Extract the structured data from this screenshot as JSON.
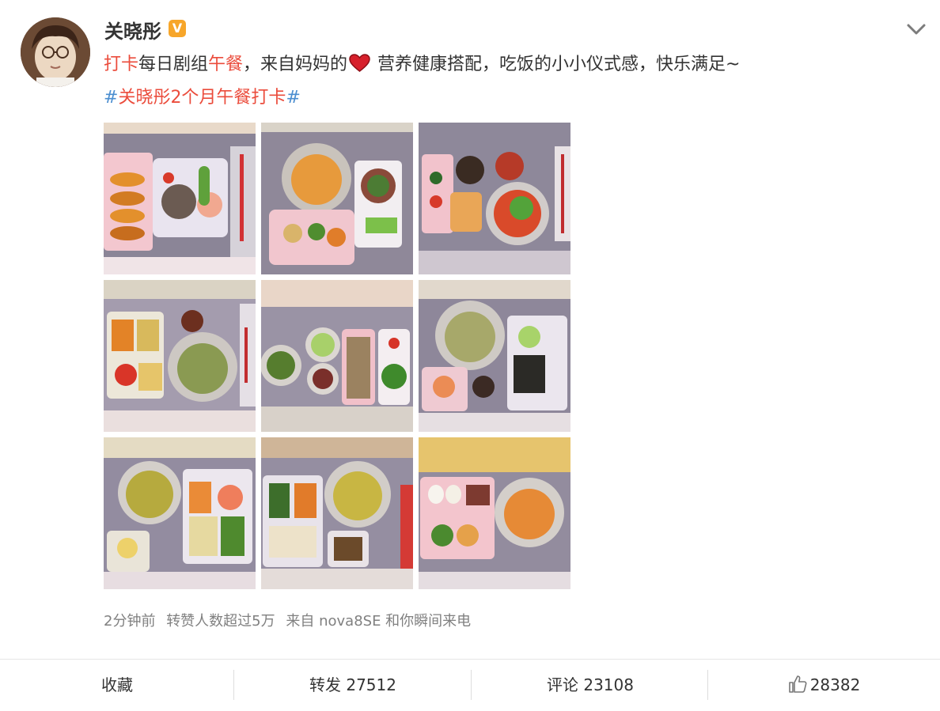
{
  "user": {
    "name": "关晓彤",
    "verified_badge": "V"
  },
  "post": {
    "text_segments": [
      {
        "text": "打卡",
        "color": "red"
      },
      {
        "text": "每日剧组",
        "color": "normal"
      },
      {
        "text": "午餐",
        "color": "red"
      },
      {
        "text": "，来自妈妈的",
        "color": "normal"
      },
      {
        "icon": "heart-icon"
      },
      {
        "text": " 营养健康搭配，吃饭的小小仪式感，快乐满足~",
        "color": "normal"
      }
    ],
    "topic_hash_open": "#",
    "topic_text": "关晓彤2个月午餐打卡",
    "topic_hash_close": "#"
  },
  "photos": [
    {
      "label": "lunch-1"
    },
    {
      "label": "lunch-2"
    },
    {
      "label": "lunch-3"
    },
    {
      "label": "lunch-4"
    },
    {
      "label": "lunch-5"
    },
    {
      "label": "lunch-6"
    },
    {
      "label": "lunch-7"
    },
    {
      "label": "lunch-8"
    },
    {
      "label": "lunch-9"
    }
  ],
  "meta": {
    "time": "2分钟前",
    "reposts_note": "转赞人数超过5万",
    "source": "来自 nova8SE 和你瞬间来电"
  },
  "actions": {
    "favorite": "收藏",
    "repost_label": "转发",
    "repost_count": "27512",
    "comment_label": "评论",
    "comment_count": "23108",
    "like_count": "28382"
  },
  "colors": {
    "accent_red": "#eb4c3c",
    "hashtag_blue": "#4b8ed0",
    "verified": "#f7a62a"
  }
}
